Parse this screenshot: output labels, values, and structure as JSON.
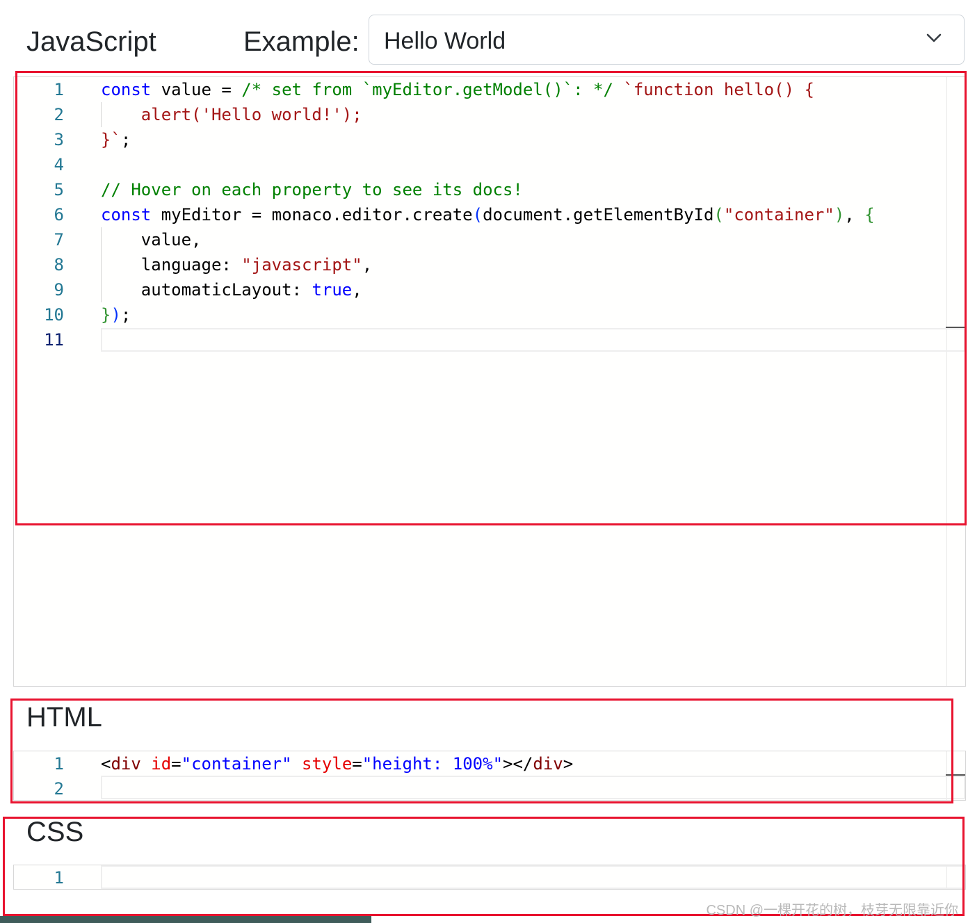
{
  "header": {
    "language_title": "JavaScript",
    "example_label": "Example:",
    "example_select": {
      "value": "Hello World"
    }
  },
  "js_editor": {
    "line_numbers": [
      "1",
      "2",
      "3",
      "4",
      "5",
      "6",
      "7",
      "8",
      "9",
      "10",
      "11"
    ],
    "lines": [
      [
        [
          "k",
          "const"
        ],
        [
          "d",
          " value = "
        ],
        [
          "c",
          "/* set from `myEditor.getModel()`: */"
        ],
        [
          "d",
          " "
        ],
        [
          "s",
          "`function hello() {"
        ]
      ],
      [
        [
          "s",
          "    alert('Hello world!');"
        ]
      ],
      [
        [
          "s",
          "}`"
        ],
        [
          "d",
          ";"
        ]
      ],
      [],
      [
        [
          "c",
          "// Hover on each property to see its docs!"
        ]
      ],
      [
        [
          "k",
          "const"
        ],
        [
          "d",
          " myEditor = monaco.editor.create"
        ],
        [
          "b1",
          "("
        ],
        [
          "d",
          "document.getElementById"
        ],
        [
          "b2",
          "("
        ],
        [
          "s",
          "\"container\""
        ],
        [
          "b2",
          ")"
        ],
        [
          "d",
          ", "
        ],
        [
          "b2",
          "{"
        ]
      ],
      [
        [
          "d",
          "    value,"
        ]
      ],
      [
        [
          "d",
          "    language: "
        ],
        [
          "s",
          "\"javascript\""
        ],
        [
          "d",
          ","
        ]
      ],
      [
        [
          "d",
          "    automaticLayout: "
        ],
        [
          "k",
          "true"
        ],
        [
          "d",
          ","
        ]
      ],
      [
        [
          "b2",
          "}"
        ],
        [
          "b1",
          ")"
        ],
        [
          "d",
          ";"
        ]
      ],
      []
    ]
  },
  "html_section": {
    "title": "HTML",
    "line_numbers": [
      "1",
      "2"
    ],
    "lines": [
      [
        [
          "d",
          "<"
        ],
        [
          "ht",
          "div"
        ],
        [
          "d",
          " "
        ],
        [
          "ha",
          "id"
        ],
        [
          "d",
          "="
        ],
        [
          "hv",
          "\"container\""
        ],
        [
          "d",
          " "
        ],
        [
          "ha",
          "style"
        ],
        [
          "d",
          "="
        ],
        [
          "hv",
          "\"height: 100%\""
        ],
        [
          "d",
          "></"
        ],
        [
          "ht",
          "div"
        ],
        [
          "d",
          ">"
        ]
      ],
      []
    ]
  },
  "css_section": {
    "title": "CSS",
    "line_numbers": [
      "1"
    ],
    "lines": [
      []
    ]
  },
  "watermark": "CSDN @一棵开花的树，枝芽无限靠近你",
  "colors": {
    "highlight_box": "#e8132f",
    "keyword": "#0000ff",
    "string": "#a31515",
    "comment": "#008000",
    "line_number": "#237893"
  }
}
